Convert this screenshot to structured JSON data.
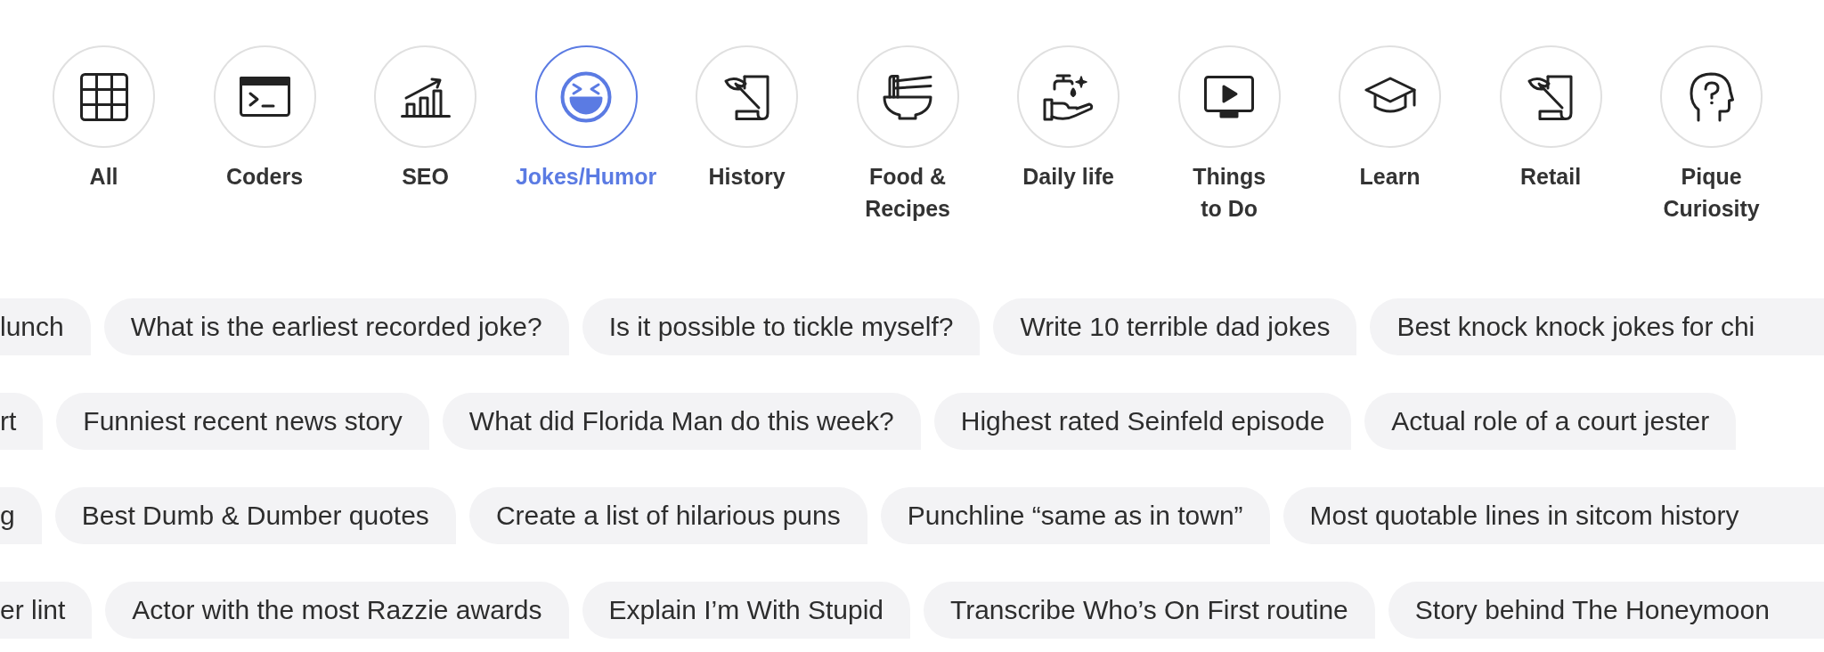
{
  "categories": [
    {
      "label": "All",
      "kind": "grid",
      "selected": false
    },
    {
      "label": "Coders",
      "kind": "terminal",
      "selected": false
    },
    {
      "label": "SEO",
      "kind": "chart",
      "selected": false
    },
    {
      "label": "Jokes/Humor",
      "kind": "laugh",
      "selected": true
    },
    {
      "label": "History",
      "kind": "quill",
      "selected": false
    },
    {
      "label": "Food & Recipes",
      "kind": "bowl",
      "selected": false
    },
    {
      "label": "Daily life",
      "kind": "handwash",
      "selected": false
    },
    {
      "label": "Things to Do",
      "kind": "video",
      "selected": false
    },
    {
      "label": "Learn",
      "kind": "cap",
      "selected": false
    },
    {
      "label": "Retail",
      "kind": "quill",
      "selected": false
    },
    {
      "label": "Pique Curiosity",
      "kind": "head",
      "selected": false
    }
  ],
  "prompt_rows": [
    {
      "chips": [
        {
          "text": "lunch",
          "cut_off": true
        },
        {
          "text": "What is the earliest recorded joke?",
          "cut_off": false
        },
        {
          "text": "Is it possible to tickle myself?",
          "cut_off": false
        },
        {
          "text": "Write 10 terrible dad jokes",
          "cut_off": false
        },
        {
          "text": "Best knock knock jokes for chi",
          "cut_off": true
        }
      ]
    },
    {
      "chips": [
        {
          "text": "rt",
          "cut_off": true
        },
        {
          "text": "Funniest recent news story",
          "cut_off": false
        },
        {
          "text": "What did Florida Man do this week?",
          "cut_off": false
        },
        {
          "text": "Highest rated Seinfeld episode",
          "cut_off": false
        },
        {
          "text": "Actual role of a court jester",
          "cut_off": false
        }
      ]
    },
    {
      "chips": [
        {
          "text": "g",
          "cut_off": true
        },
        {
          "text": "Best Dumb & Dumber quotes",
          "cut_off": false
        },
        {
          "text": "Create a list of hilarious puns",
          "cut_off": false
        },
        {
          "text": "Punchline “same as in town”",
          "cut_off": false
        },
        {
          "text": "Most quotable lines in sitcom history",
          "cut_off": true
        }
      ]
    },
    {
      "chips": [
        {
          "text": "er lint",
          "cut_off": true
        },
        {
          "text": "Actor with the most Razzie awards",
          "cut_off": false
        },
        {
          "text": "Explain I’m With Stupid",
          "cut_off": false
        },
        {
          "text": "Transcribe Who’s On First routine",
          "cut_off": false
        },
        {
          "text": "Story behind The Honeymoon",
          "cut_off": true
        }
      ]
    }
  ]
}
